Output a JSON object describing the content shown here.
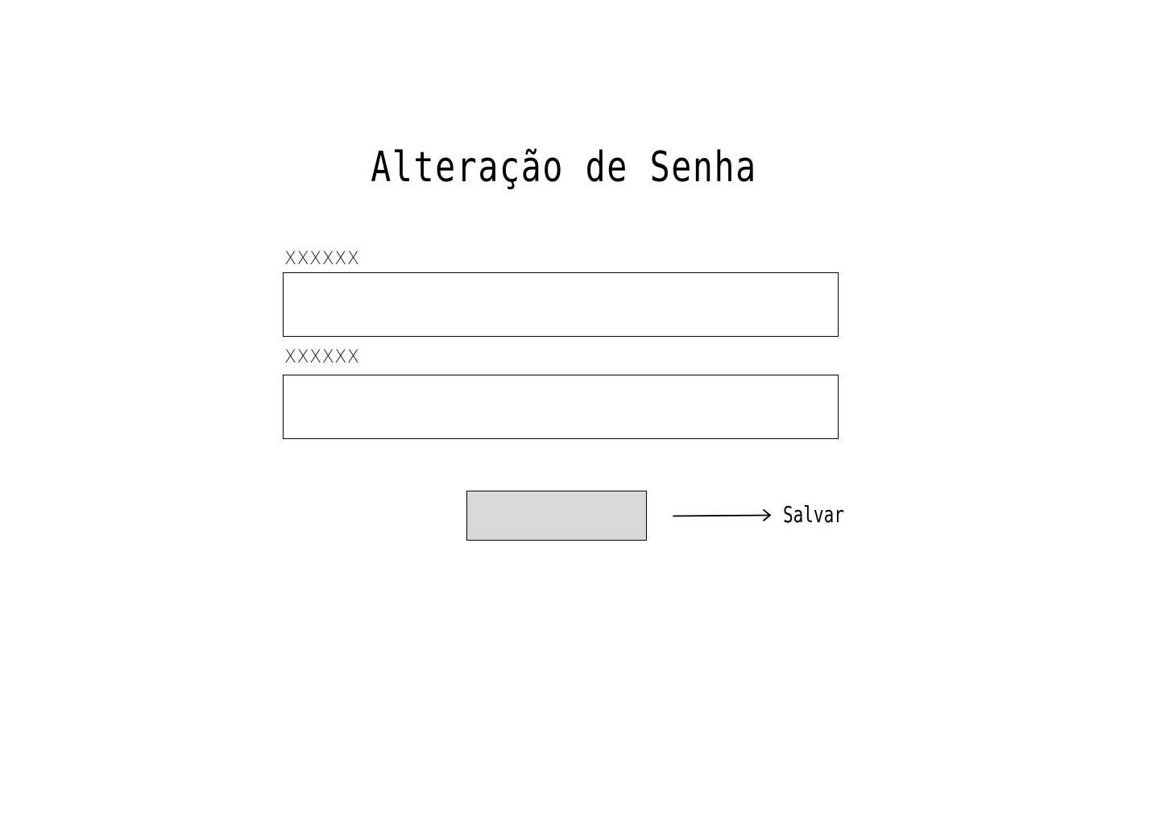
{
  "header": {
    "title": "Alteração de Senha"
  },
  "form": {
    "fields": [
      {
        "label": "XXXXXX",
        "value": ""
      },
      {
        "label": "XXXXXX",
        "value": ""
      }
    ],
    "save_button_label": ""
  },
  "annotation": {
    "label": "Salvar"
  },
  "colors": {
    "background": "#ffffff",
    "button_fill": "#d9d9d9",
    "border": "#000000"
  },
  "icons": {
    "annotation_arrow": "arrow-right-icon"
  }
}
